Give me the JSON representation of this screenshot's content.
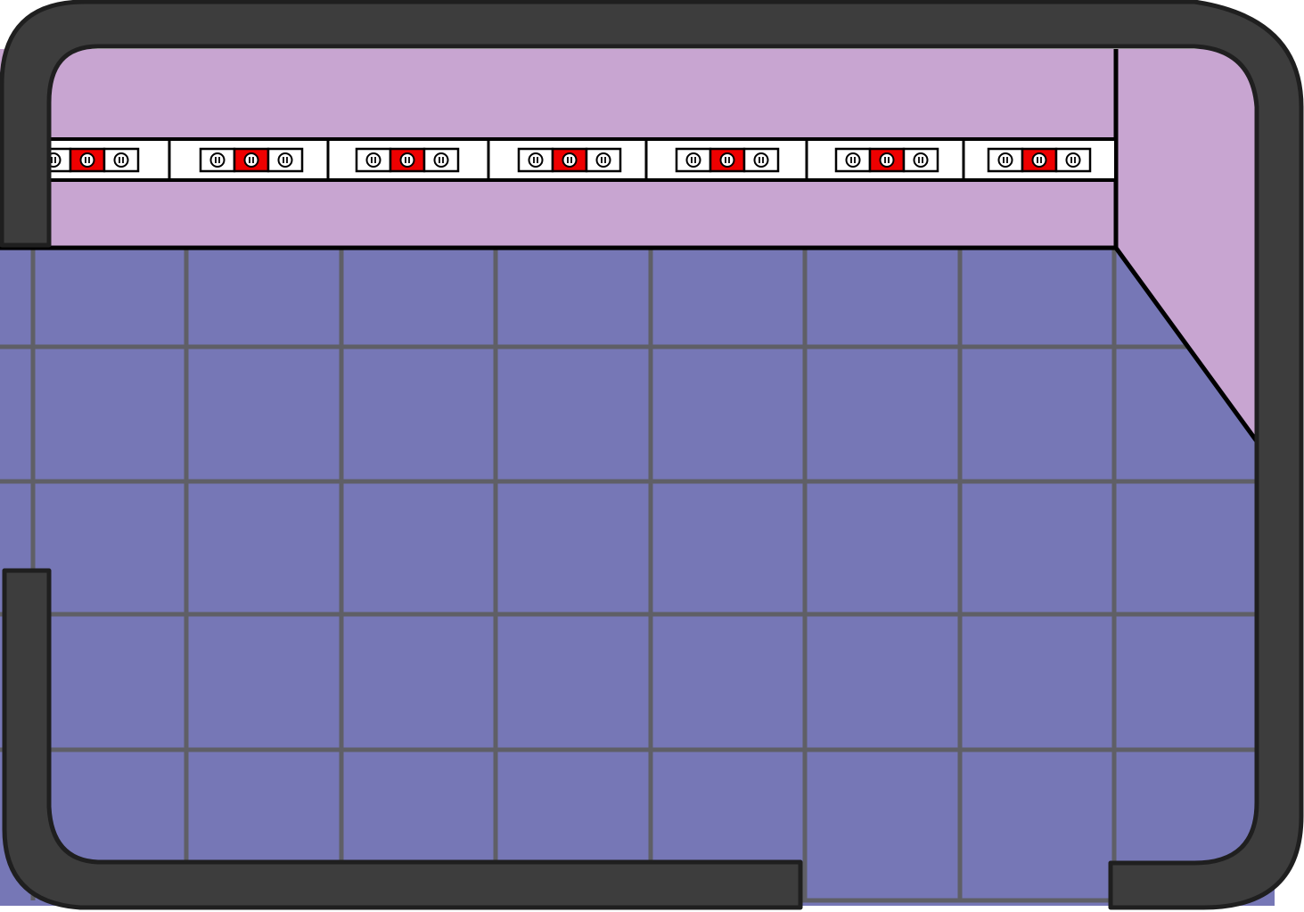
{
  "scene": {
    "kind": "top-down game room",
    "colors": {
      "wall": "#3d3d3d",
      "wall_outline": "#1f1f1f",
      "back_wall": "#c8a5d1",
      "floor": "#7677b6",
      "floor_grid": "#5f5f66",
      "outline": "#000000",
      "rail": "#ffffff",
      "slot_border": "#000000",
      "slot_plain": "#ffffff",
      "slot_active": "#ee0000"
    },
    "rail": {
      "sections": 7,
      "slots_per_unit": 3,
      "active_slot_index": 1,
      "slot_icon": "pause-icon"
    },
    "floor_grid": {
      "columns": 8,
      "rows": 5
    },
    "openings": [
      "left-wall-doorway",
      "bottom-wall-doorway"
    ]
  }
}
